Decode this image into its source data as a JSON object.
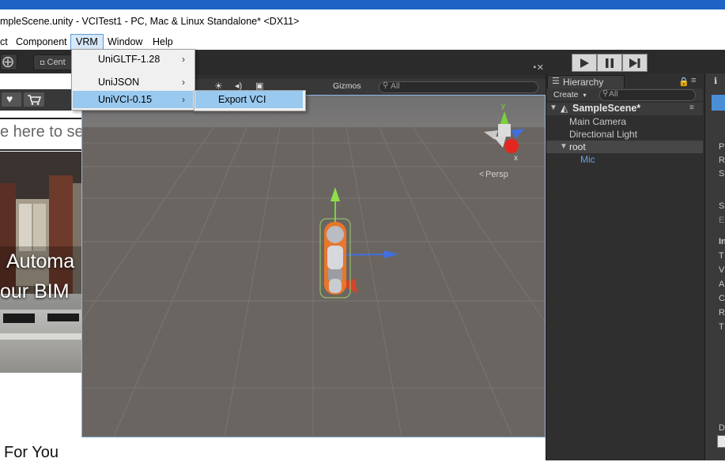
{
  "window": {
    "title": "mpleScene.unity - VCITest1 - PC, Mac & Linux Standalone* <DX11>"
  },
  "menubar": {
    "items": [
      "ct",
      "Component",
      "VRM",
      "Window",
      "Help"
    ]
  },
  "toolbar": {
    "pivot_label": "Cent",
    "gizmos_label": "Gizmos",
    "gizmos_search_placeholder": "All"
  },
  "vrm_menu": {
    "items": [
      {
        "label": "UniGLTF-1.28",
        "has_submenu": true
      },
      {
        "label": "UniJSON",
        "has_submenu": true
      },
      {
        "label": "UniVCI-0.15",
        "has_submenu": true
      }
    ],
    "submenu": {
      "items": [
        {
          "label": "Export VCI"
        }
      ]
    },
    "highlight_color": "#99c9ef"
  },
  "scene": {
    "persp_label": "Persp",
    "gizmo_axes": {
      "y": "y",
      "x": "x"
    }
  },
  "hierarchy": {
    "tab_label": "Hierarchy",
    "create_label": "Create",
    "search_placeholder": "All",
    "scene_name": "SampleScene*",
    "rows": [
      {
        "label": "Main Camera"
      },
      {
        "label": "Directional Light"
      },
      {
        "label": "root"
      },
      {
        "label": "Mic"
      }
    ]
  },
  "inspector": {
    "letters": [
      "P",
      "R",
      "S",
      "S",
      "E",
      "In",
      "T",
      "V",
      "A",
      "C",
      "R",
      "T",
      "D"
    ]
  },
  "webpage": {
    "search_text": "e here to sea",
    "banner_line1": "Automa",
    "banner_line2": "our BIM",
    "bottom_text": "For You"
  },
  "colors": {
    "unity_dark": "#2f2f2f",
    "scene_bg": "#6b6561",
    "accent_blue": "#5b9bd5",
    "mic_blue": "#6f9fe6"
  }
}
